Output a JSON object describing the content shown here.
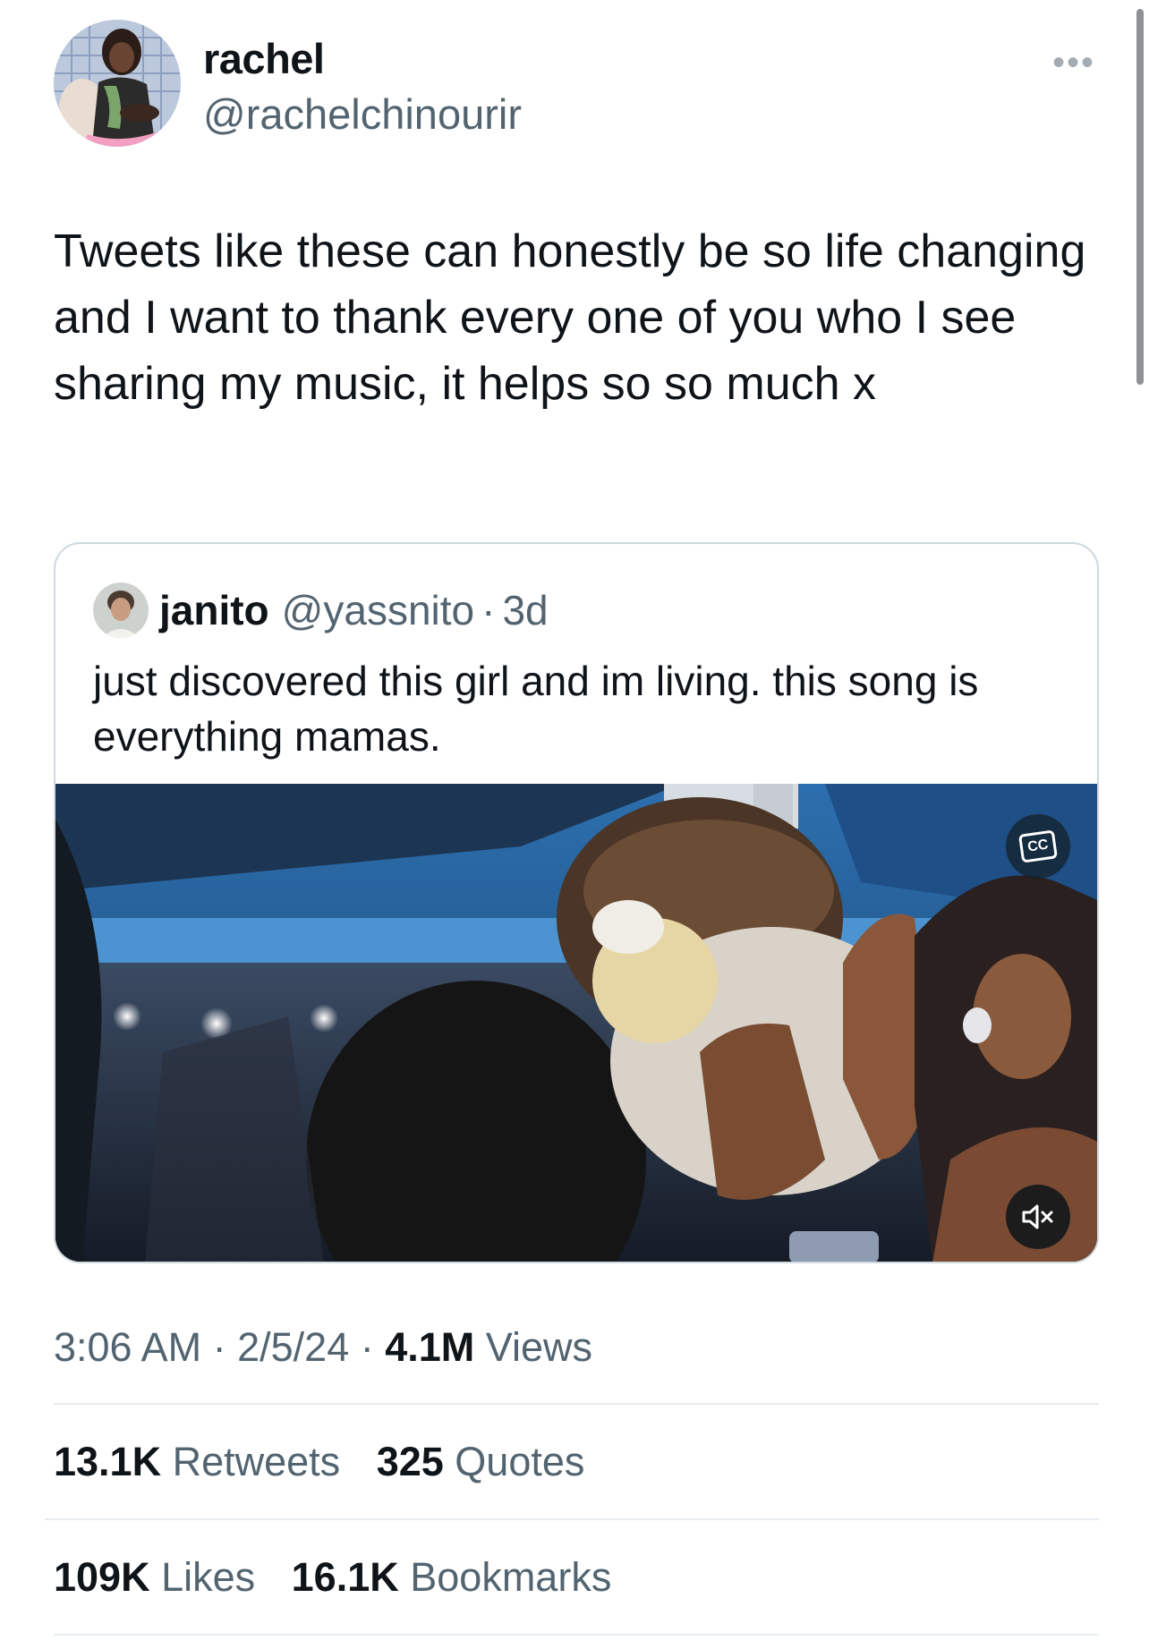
{
  "author": {
    "display_name": "rachel",
    "handle": "@rachelchinourir",
    "more_icon": "more-horizontal-icon"
  },
  "tweet": {
    "text": "Tweets like these can honestly be so life changing and I want to thank every one of you who I see sharing my music, it helps so so much x"
  },
  "quoted_tweet": {
    "display_name": "janito",
    "handle": "@yassnito",
    "separator": "·",
    "time": "3d",
    "text": "just discovered this girl and im living. this song is everything mamas.",
    "media": {
      "captions_icon": "closed-captions-icon",
      "captions_label": "CC",
      "mute_icon": "volume-muted-icon"
    }
  },
  "meta": {
    "time": "3:06 AM",
    "sep1": " · ",
    "date": "2/5/24",
    "sep2": " · ",
    "views_count": "4.1M",
    "views_label": " Views"
  },
  "stats": {
    "retweets_count": "13.1K",
    "retweets_label": " Retweets",
    "quotes_count": "325",
    "quotes_label": " Quotes",
    "likes_count": "109K",
    "likes_label": " Likes",
    "bookmarks_count": "16.1K",
    "bookmarks_label": " Bookmarks"
  },
  "colors": {
    "primary_text": "#0f1419",
    "secondary_text": "#536471",
    "border": "#cfd9de"
  }
}
